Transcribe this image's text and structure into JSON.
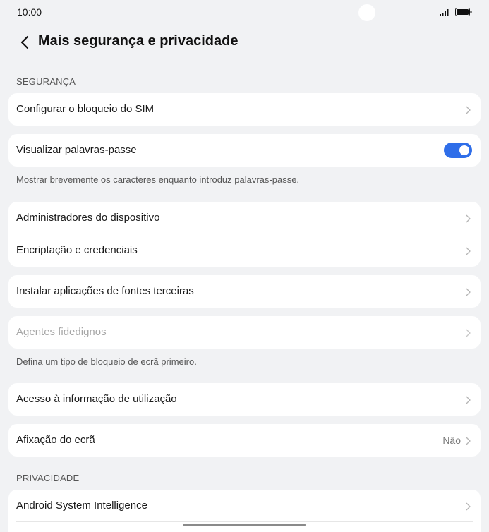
{
  "status_bar": {
    "time": "10:00"
  },
  "header": {
    "title": "Mais segurança e privacidade"
  },
  "sections": {
    "security_label": "SEGURANÇA",
    "privacy_label": "PRIVACIDADE"
  },
  "items": {
    "sim_lock": "Configurar o bloqueio do SIM",
    "show_passwords": "Visualizar palavras-passe",
    "show_passwords_note": "Mostrar brevemente os caracteres enquanto introduz palavras-passe.",
    "device_admins": "Administradores do dispositivo",
    "encryption": "Encriptação e credenciais",
    "install_third_party": "Instalar aplicações de fontes terceiras",
    "trust_agents": "Agentes fidedignos",
    "trust_agents_note": "Defina um tipo de bloqueio de ecrã primeiro.",
    "usage_access": "Acesso à informação de utilização",
    "screen_pinning": "Afixação do ecrã",
    "screen_pinning_value": "Não",
    "asi": "Android System Intelligence"
  },
  "toggle_state": {
    "show_passwords": true
  },
  "colors": {
    "accent": "#2f6ee9",
    "background": "#f1f2f4"
  },
  "icons": [
    "back-arrow-icon",
    "chevron-right-icon",
    "signal-icon",
    "battery-icon"
  ]
}
